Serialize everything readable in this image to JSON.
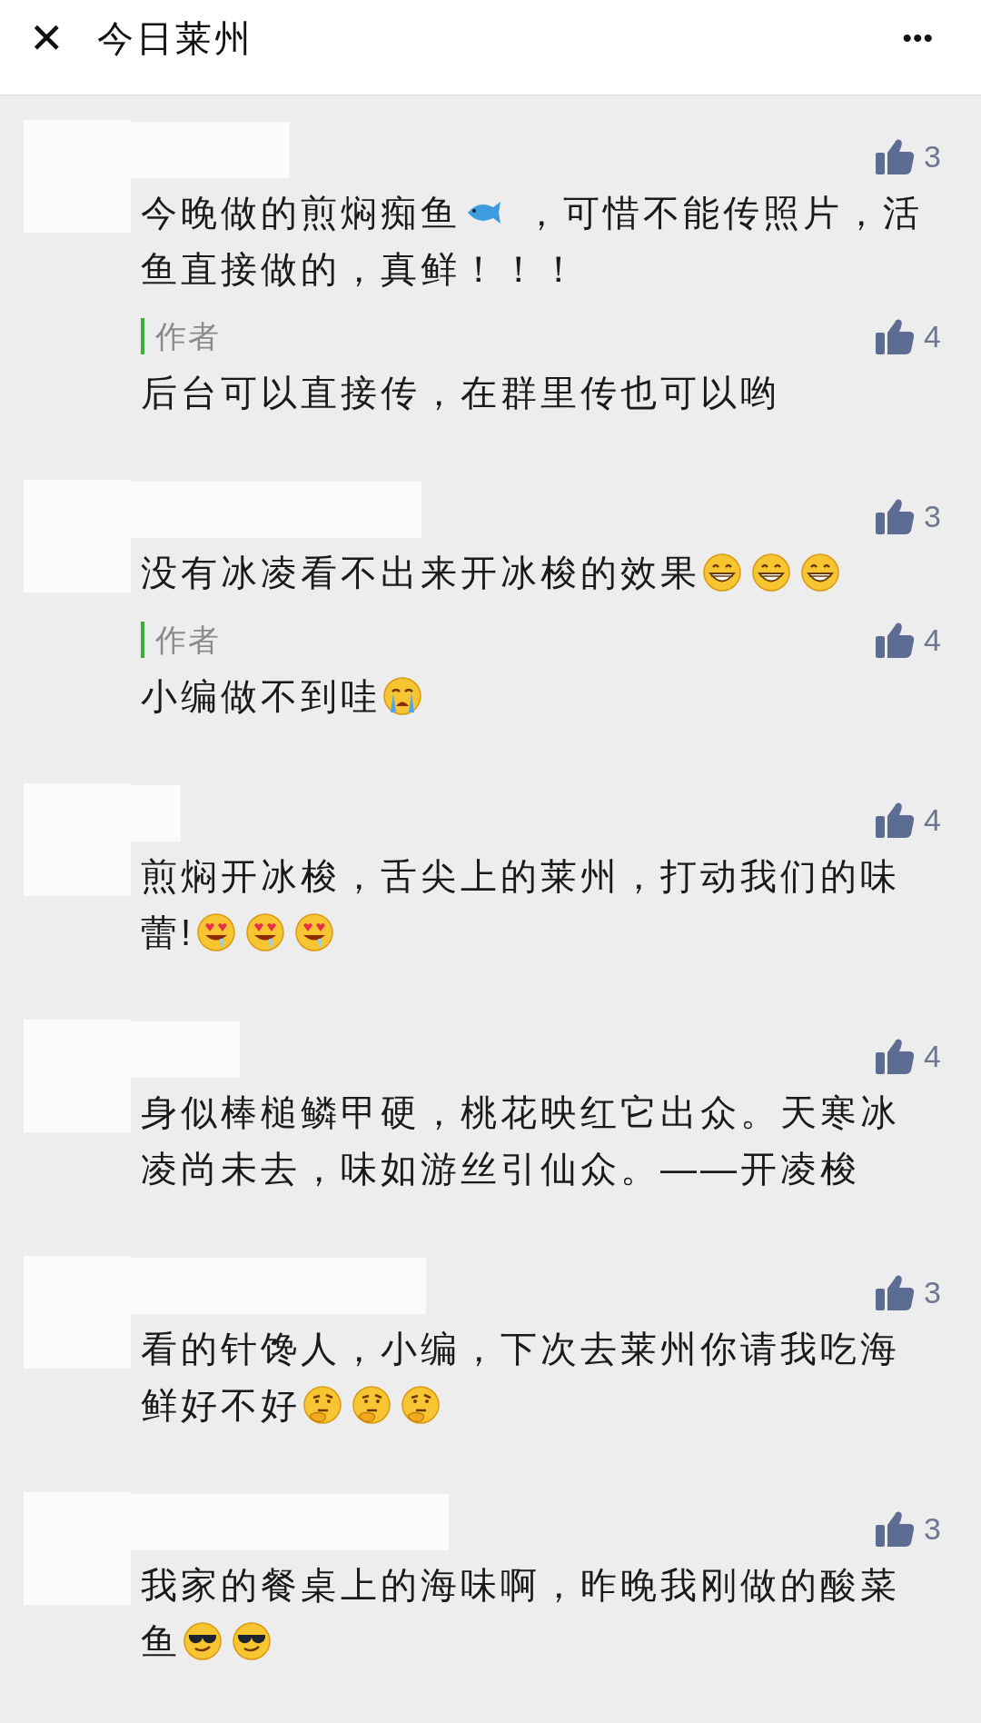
{
  "header": {
    "close": "✕",
    "title": "今日莱州",
    "more": "•••"
  },
  "comments": [
    {
      "likes": "3",
      "lines": [
        [
          {
            "kind": "text",
            "text": "今晚做的煎焖痴鱼"
          },
          {
            "kind": "fish"
          },
          {
            "kind": "text",
            "text": " ，可惜不能传照片，活"
          }
        ],
        [
          {
            "kind": "text",
            "text": "鱼直接做的，真鲜！！！"
          }
        ]
      ],
      "reply": {
        "label": "作者",
        "likes": "4",
        "lines": [
          [
            {
              "kind": "text",
              "text": "后台可以直接传，在群里传也可以哟"
            }
          ]
        ]
      }
    },
    {
      "likes": "3",
      "lines": [
        [
          {
            "kind": "text",
            "text": "没有冰凌看不出来开冰梭的效果"
          },
          {
            "kind": "grin"
          },
          {
            "kind": "grin"
          },
          {
            "kind": "grin"
          }
        ]
      ],
      "reply": {
        "label": "作者",
        "likes": "4",
        "lines": [
          [
            {
              "kind": "text",
              "text": "小编做不到哇"
            },
            {
              "kind": "cry"
            }
          ]
        ]
      }
    },
    {
      "likes": "4",
      "lines": [
        [
          {
            "kind": "text",
            "text": "煎焖开冰梭，舌尖上的莱州，打动我们的味"
          }
        ],
        [
          {
            "kind": "text",
            "text": "蕾!"
          },
          {
            "kind": "drool"
          },
          {
            "kind": "drool"
          },
          {
            "kind": "drool"
          }
        ]
      ]
    },
    {
      "likes": "4",
      "lines": [
        [
          {
            "kind": "text",
            "text": "身似棒槌鳞甲硬，桃花映红它出众。天寒冰"
          }
        ],
        [
          {
            "kind": "text",
            "text": "凌尚未去，味如游丝引仙众。——开凌梭"
          }
        ]
      ]
    },
    {
      "likes": "3",
      "lines": [
        [
          {
            "kind": "text",
            "text": "看的针馋人，小编，下次去莱州你请我吃海"
          }
        ],
        [
          {
            "kind": "text",
            "text": "鲜好不好"
          },
          {
            "kind": "think"
          },
          {
            "kind": "think"
          },
          {
            "kind": "think"
          }
        ]
      ]
    },
    {
      "likes": "3",
      "lines": [
        [
          {
            "kind": "text",
            "text": "我家的餐桌上的海味啊，昨晚我刚做的酸菜"
          }
        ],
        [
          {
            "kind": "text",
            "text": "鱼"
          },
          {
            "kind": "cool"
          },
          {
            "kind": "cool"
          }
        ]
      ]
    }
  ]
}
